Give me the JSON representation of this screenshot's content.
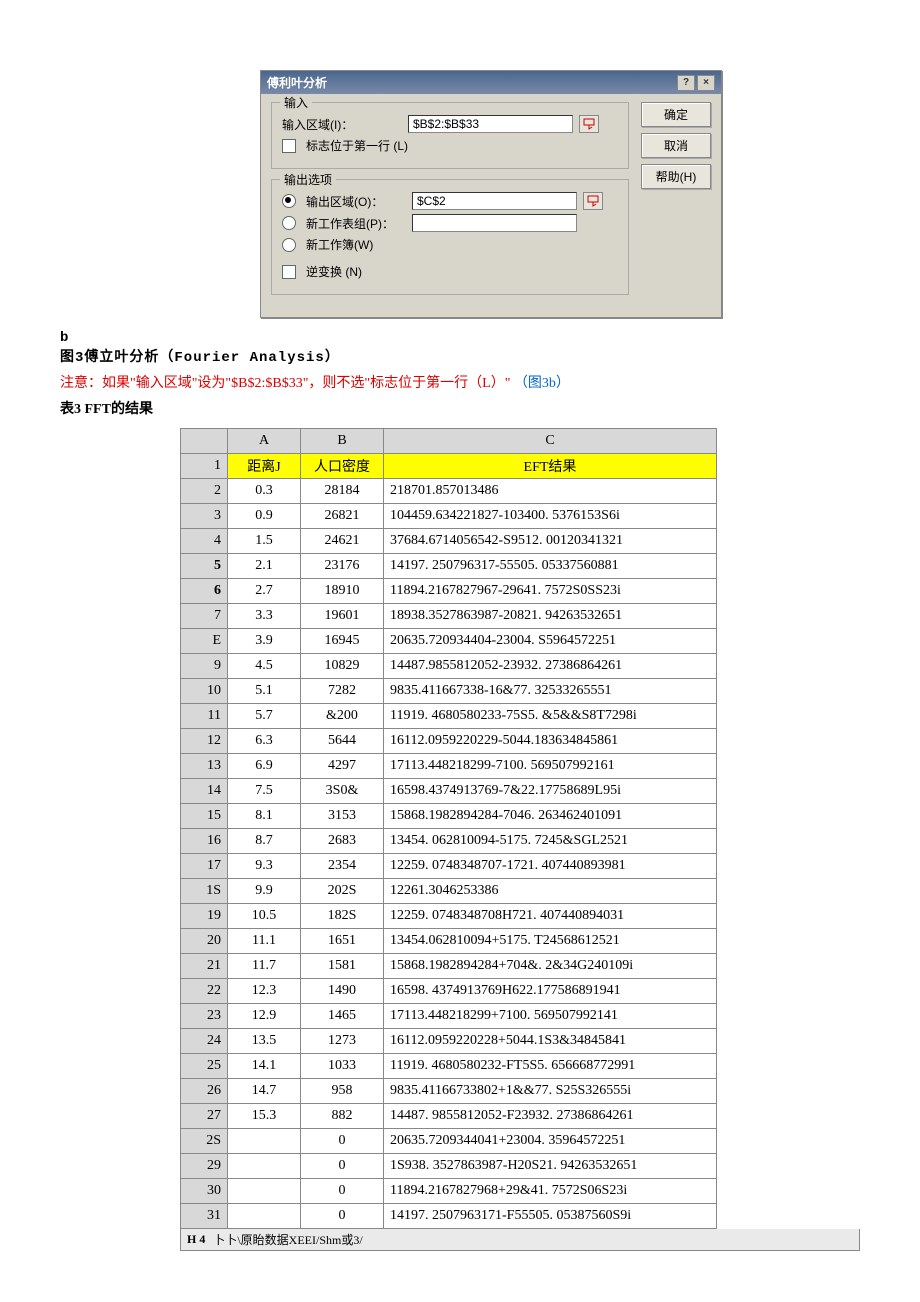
{
  "dialog": {
    "title": "傅利叶分析",
    "help_btn": "?",
    "close_btn": "×",
    "group_input": "输入",
    "input_range_label": "输入区域(I)：",
    "input_range_value": "$B$2:$B$33",
    "first_row_label": "标志位于第一行 (L)",
    "group_output": "输出选项",
    "out_range_label": "输出区域(O)：",
    "out_range_value": "$C$2",
    "out_new_sheet": "新工作表组(P)：",
    "out_new_book": "新工作簿(W)",
    "inverse_label": "逆变换 (N)",
    "btn_ok": "确定",
    "btn_cancel": "取消",
    "btn_help": "帮助(H)"
  },
  "text": {
    "b_label": "b",
    "fig_caption": "图3傅立叶分析（Fourier Analysis）",
    "note_prefix": "注意：如果\"输入区域\"设为\"$B$2:$B$33\"，则不选\"标志位于第一行（L）\"",
    "note_suffix": "（图3b）",
    "table_caption": "表3 FFT的结果"
  },
  "sheet": {
    "col_labels": [
      "A",
      "B",
      "C"
    ],
    "row1": {
      "A": "距离J",
      "B": "人口密度",
      "C": "EFT结果"
    },
    "rows": [
      {
        "n": "2",
        "a": "0.3",
        "b": "28184",
        "c": "218701.857013486"
      },
      {
        "n": "3",
        "a": "0.9",
        "b": "26821",
        "c": "104459.634221827-103400. 5376153S6i"
      },
      {
        "n": "4",
        "a": "1.5",
        "b": "24621",
        "c": "37684.6714056542-S9512. 00120341321"
      },
      {
        "n": "5",
        "a": "2.1",
        "b": "23176",
        "c": "14197. 250796317-55505. 05337560881",
        "bold": true
      },
      {
        "n": "6",
        "a": "2.7",
        "b": "18910",
        "c": "11894.2167827967-29641. 7572S0SS23i",
        "bold": true
      },
      {
        "n": "7",
        "a": "3.3",
        "b": "19601",
        "c": "18938.3527863987-20821. 94263532651"
      },
      {
        "n": "E",
        "a": "3.9",
        "b": "16945",
        "c": "20635.720934404-23004. S5964572251"
      },
      {
        "n": "9",
        "a": "4.5",
        "b": "10829",
        "c": "14487.9855812052-23932. 27386864261"
      },
      {
        "n": "10",
        "a": "5.1",
        "b": "7282",
        "c": "9835.411667338-16&77. 32533265551"
      },
      {
        "n": "11",
        "a": "5.7",
        "b": "&200",
        "c": "11919. 4680580233-75S5. &5&&S8T7298i"
      },
      {
        "n": "12",
        "a": "6.3",
        "b": "5644",
        "c": "16112.0959220229-5044.183634845861"
      },
      {
        "n": "13",
        "a": "6.9",
        "b": "4297",
        "c": "17113.448218299-7100. 569507992161"
      },
      {
        "n": "14",
        "a": "7.5",
        "b": "3S0&",
        "c": "16598.4374913769-7&22.17758689L95i"
      },
      {
        "n": "15",
        "a": "8.1",
        "b": "3153",
        "c": "15868.1982894284-7046. 263462401091"
      },
      {
        "n": "16",
        "a": "8.7",
        "b": "2683",
        "c": "13454. 062810094-5175. 7245&SGL2521"
      },
      {
        "n": "17",
        "a": "9.3",
        "b": "2354",
        "c": "12259. 0748348707-1721. 407440893981"
      },
      {
        "n": "1S",
        "a": "9.9",
        "b": "202S",
        "c": "12261.3046253386"
      },
      {
        "n": "19",
        "a": "10.5",
        "b": "182S",
        "c": "12259. 0748348708H721. 407440894031"
      },
      {
        "n": "20",
        "a": "11.1",
        "b": "1651",
        "c": "13454.062810094+5175. T24568612521"
      },
      {
        "n": "21",
        "a": "11.7",
        "b": "1581",
        "c": "15868.1982894284+704&. 2&34G240109i"
      },
      {
        "n": "22",
        "a": "12.3",
        "b": "1490",
        "c": "16598. 4374913769H622.177586891941"
      },
      {
        "n": "23",
        "a": "12.9",
        "b": "1465",
        "c": "17113.448218299+7100. 569507992141"
      },
      {
        "n": "24",
        "a": "13.5",
        "b": "1273",
        "c": "16112.0959220228+5044.1S3&34845841"
      },
      {
        "n": "25",
        "a": "14.1",
        "b": "1033",
        "c": "11919. 4680580232-FT5S5. 656668772991"
      },
      {
        "n": "26",
        "a": "14.7",
        "b": "958",
        "c": "9835.41166733802+1&&77. S25S326555i"
      },
      {
        "n": "27",
        "a": "15.3",
        "b": "882",
        "c": "14487. 9855812052-F23932. 27386864261"
      },
      {
        "n": "2S",
        "a": "",
        "b": "0",
        "c": "20635.7209344041+23004. 35964572251"
      },
      {
        "n": "29",
        "a": "",
        "b": "0",
        "c": "1S938. 3527863987-H20S21. 94263532651"
      },
      {
        "n": "30",
        "a": "",
        "b": "0",
        "c": "11894.2167827968+29&41. 7572S06S23i"
      },
      {
        "n": "31",
        "a": "",
        "b": "0",
        "c": "14197. 2507963171-F55505. 05387560S9i"
      }
    ],
    "footer_nav": "H 4",
    "footer_tabs": "卜卜\\原眙数据XEEI/Shm或3/"
  }
}
